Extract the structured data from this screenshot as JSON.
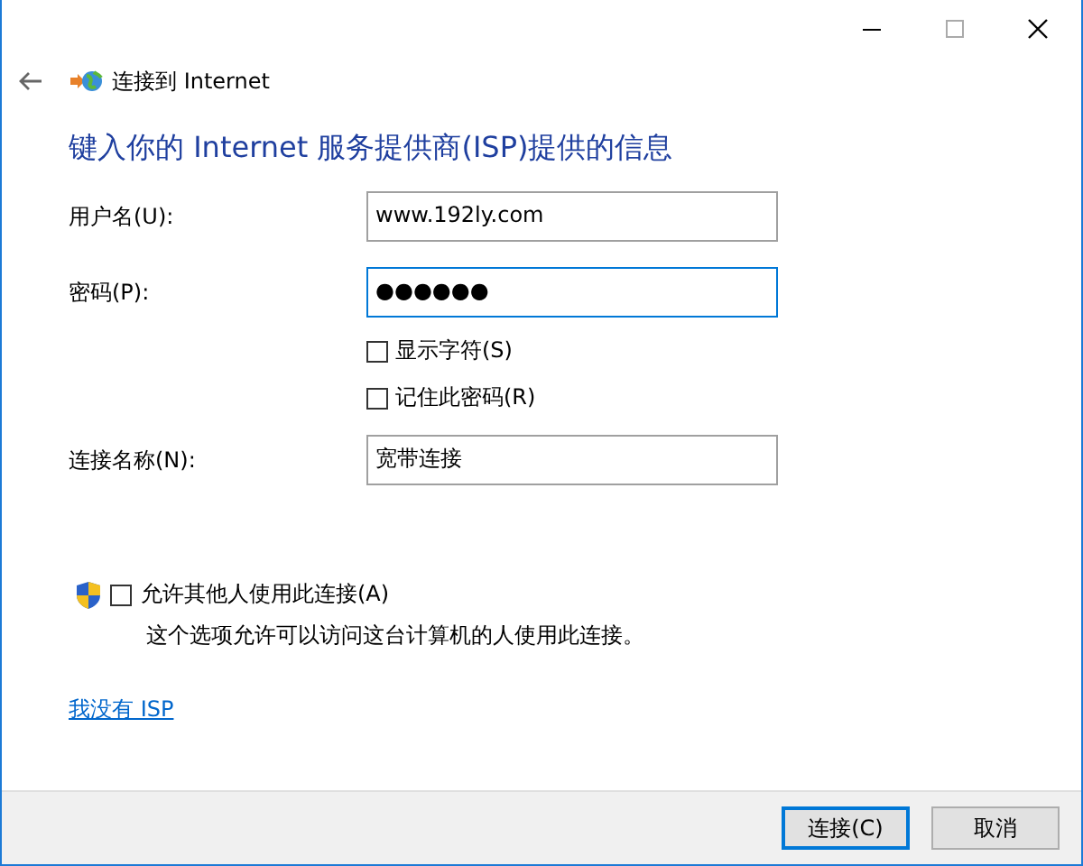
{
  "window": {
    "title": "连接到 Internet"
  },
  "heading": "键入你的 Internet 服务提供商(ISP)提供的信息",
  "fields": [
    {
      "label": "用户名(U):",
      "value": "www.192ly.com",
      "focused": false
    },
    {
      "label": "密码(P):",
      "value": "●●●●●●",
      "focused": true
    }
  ],
  "password_options": [
    {
      "label": "显示字符(S)",
      "checked": false
    },
    {
      "label": "记住此密码(R)",
      "checked": false
    }
  ],
  "connection_name": {
    "label": "连接名称(N):",
    "value": "宽带连接",
    "focused": false
  },
  "allow_others": {
    "label": "允许其他人使用此连接(A)",
    "checked": false,
    "description": "这个选项允许可以访问这台计算机的人使用此连接。"
  },
  "link": "我没有 ISP",
  "buttons": [
    {
      "label": "连接(C)",
      "default": true
    },
    {
      "label": "取消",
      "default": false
    }
  ]
}
